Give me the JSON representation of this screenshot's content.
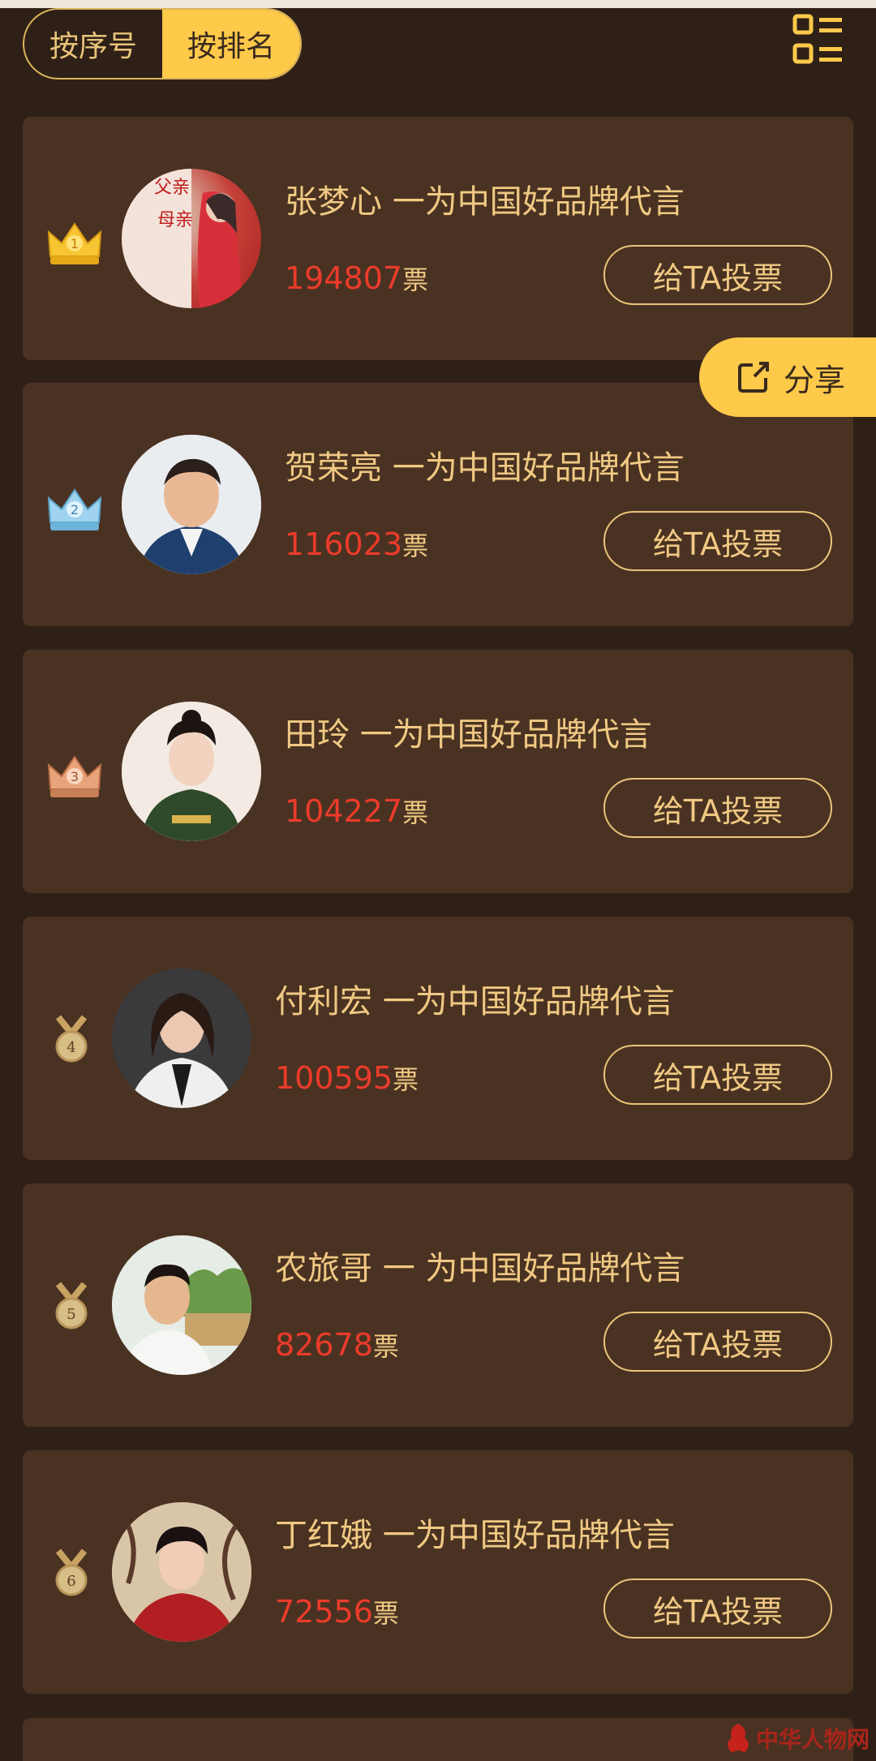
{
  "toggle": {
    "by_number": "按序号",
    "by_rank": "按排名"
  },
  "share_label": "分享",
  "vote_label": "给TA投票",
  "vote_unit": "票",
  "entries": [
    {
      "rank": "1",
      "title": "张梦心 一为中国好品牌代言",
      "votes": "194807"
    },
    {
      "rank": "2",
      "title": "贺荣亮 一为中国好品牌代言",
      "votes": "116023"
    },
    {
      "rank": "3",
      "title": "田玲 一为中国好品牌代言",
      "votes": "104227"
    },
    {
      "rank": "4",
      "title": "付利宏 一为中国好品牌代言",
      "votes": "100595"
    },
    {
      "rank": "5",
      "title": "农旅哥 一 为中国好品牌代言",
      "votes": "82678"
    },
    {
      "rank": "6",
      "title": "丁红娥 一为中国好品牌代言",
      "votes": "72556"
    }
  ],
  "watermark": "中华人物网",
  "colors": {
    "background": "#2f2017",
    "card": "#4a3222",
    "accent": "#ffc94a",
    "gold_text": "#f0c983",
    "vote_number": "#ec3b2a"
  },
  "icons": {
    "rank_1": "gold-crown-icon",
    "rank_2": "silver-crown-icon",
    "rank_3": "bronze-crown-icon",
    "rank_4_6": "medal-icon",
    "list_toggle": "list-grid-icon",
    "share": "share-icon"
  }
}
